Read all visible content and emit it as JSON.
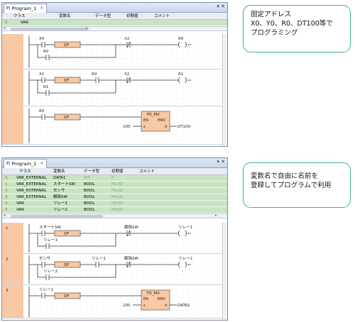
{
  "window1": {
    "tab_label": "Program_1",
    "headers": [
      "クラス",
      "変数名",
      "データ型",
      "初期値",
      "コメント"
    ],
    "rows": [
      {
        "no": "0",
        "cls": "VAR"
      }
    ],
    "rungs": [
      {
        "num": "",
        "contact1": "X0",
        "instr": "DF",
        "contact2": "X2",
        "coil": "R0",
        "branch": "R0"
      },
      {
        "num": "",
        "contact1": "X1",
        "instr": "DF",
        "contact_mid": "R0",
        "contact2": "X2",
        "coil": "R1",
        "branch": "R1"
      },
      {
        "num": "",
        "contact1": "R0",
        "instr": "DF",
        "fb_name": "F0_MV",
        "fb_en": "EN",
        "fb_eno": "ENO",
        "fb_s": "s",
        "fb_d": "d",
        "fb_in": "100",
        "fb_out": "DT100"
      }
    ]
  },
  "window2": {
    "tab_label": "Program_1",
    "headers": [
      "クラス",
      "変数名",
      "データ型",
      "初期値",
      "コメント"
    ],
    "rows": [
      {
        "no": "0",
        "cls": "VAR_EXTERNAL",
        "name": "DATA1",
        "type": "INT",
        "init": "0"
      },
      {
        "no": "1",
        "cls": "VAR_EXTERNAL",
        "name": "スタートSW",
        "type": "BOOL",
        "init": "FALSE"
      },
      {
        "no": "2",
        "cls": "VAR_EXTERNAL",
        "name": "センサ",
        "type": "BOOL",
        "init": "FALSE"
      },
      {
        "no": "3",
        "cls": "VAR_EXTERNAL",
        "name": "解除SW",
        "type": "BOOL",
        "init": "FALSE"
      },
      {
        "no": "4",
        "cls": "VAR",
        "name": "リレー1",
        "type": "BOOL",
        "init": "FALSE"
      },
      {
        "no": "5",
        "cls": "VAR",
        "name": "リレー2",
        "type": "BOOL",
        "init": "FALSE"
      }
    ],
    "rungs": [
      {
        "num": "1",
        "contact1": "スタートSW",
        "instr": "DF",
        "contact2": "解除SW",
        "coil": "リレー1",
        "branch": "リレー1"
      },
      {
        "num": "2",
        "contact1": "センサ",
        "instr": "DF",
        "contact_mid": "リレー1",
        "contact2": "解除SW",
        "coil": "リレー2",
        "branch": "リレー2"
      },
      {
        "num": "3",
        "contact1": "リレー1",
        "instr": "DF",
        "fb_name": "F0_MV",
        "fb_en": "EN",
        "fb_eno": "ENO",
        "fb_s": "s",
        "fb_d": "d",
        "fb_in": "100",
        "fb_out": "DATA1"
      }
    ]
  },
  "note1": {
    "lines": [
      "固定アドレス",
      "X0、Y0、R0、DT100等で",
      "プログラミング"
    ]
  },
  "note2": {
    "lines": [
      "変数名で自由に名前を",
      "登録してプログラムで利用"
    ]
  },
  "colors": {
    "rung_margin": "#f8c9a4",
    "grid_row": "#c9e4c3",
    "instr_fill": "#f8c9a4",
    "note_border": "#3ab09c",
    "rung_no": "#c9541a"
  }
}
